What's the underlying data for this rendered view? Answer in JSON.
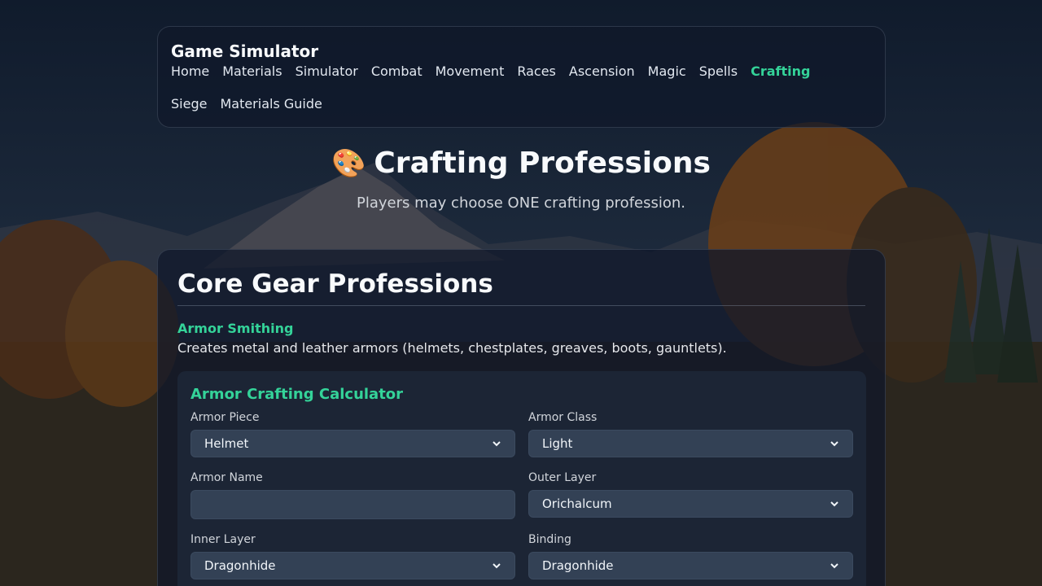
{
  "nav": {
    "brand": "Game Simulator",
    "links": [
      "Home",
      "Materials",
      "Simulator",
      "Combat",
      "Movement",
      "Races",
      "Ascension",
      "Magic",
      "Spells",
      "Crafting",
      "Siege",
      "Materials Guide"
    ],
    "active": "Crafting"
  },
  "hero": {
    "emoji": "🎨",
    "title": "Crafting Professions",
    "subtitle": "Players may choose ONE crafting profession."
  },
  "section": {
    "title": "Core Gear Professions",
    "profession_name": "Armor Smithing",
    "profession_desc": "Creates metal and leather armors (helmets, chestplates, greaves, boots, gauntlets)."
  },
  "calculator": {
    "title": "Armor Crafting Calculator",
    "armor_piece": {
      "label": "Armor Piece",
      "value": "Helmet"
    },
    "armor_class": {
      "label": "Armor Class",
      "value": "Light"
    },
    "armor_name": {
      "label": "Armor Name",
      "value": ""
    },
    "outer_layer": {
      "label": "Outer Layer",
      "value": "Orichalcum"
    },
    "inner_layer": {
      "label": "Inner Layer",
      "value": "Dragonhide"
    },
    "binding": {
      "label": "Binding",
      "value": "Dragonhide"
    }
  },
  "colors": {
    "accent": "#34d399",
    "panel_bg": "#0f172a",
    "field_bg": "#334155"
  }
}
